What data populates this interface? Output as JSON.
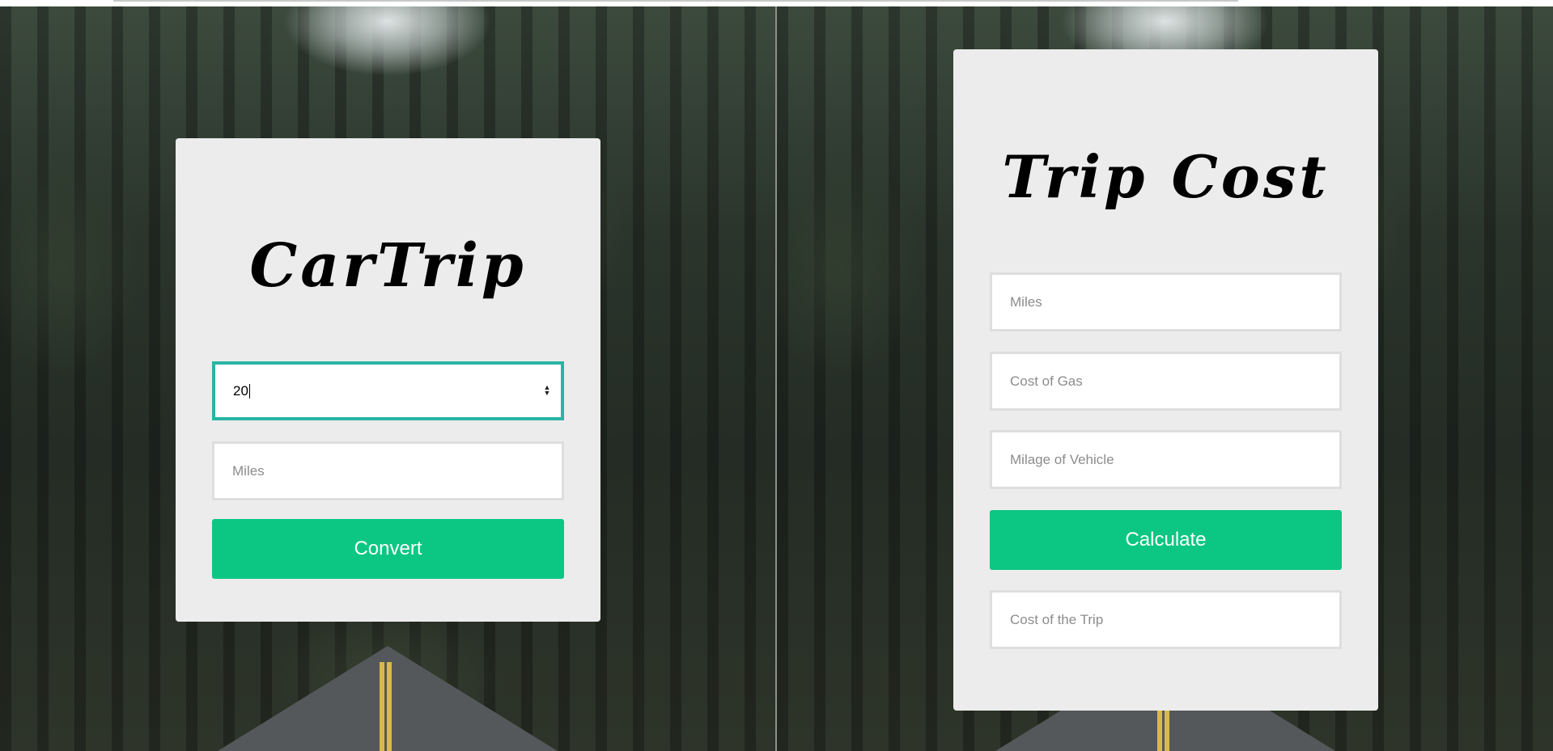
{
  "colors": {
    "accent": "#0bc783",
    "focus_border": "#2ab4a4",
    "card_bg": "#ececec"
  },
  "converter": {
    "title": "CarTrip",
    "input_value": "20",
    "miles_placeholder": "Miles",
    "button_label": "Convert"
  },
  "trip_cost": {
    "title": "Trip Cost",
    "miles_placeholder": "Miles",
    "gas_placeholder": "Cost of Gas",
    "milage_placeholder": "Milage of Vehicle",
    "button_label": "Calculate",
    "result_placeholder": "Cost of the Trip"
  }
}
